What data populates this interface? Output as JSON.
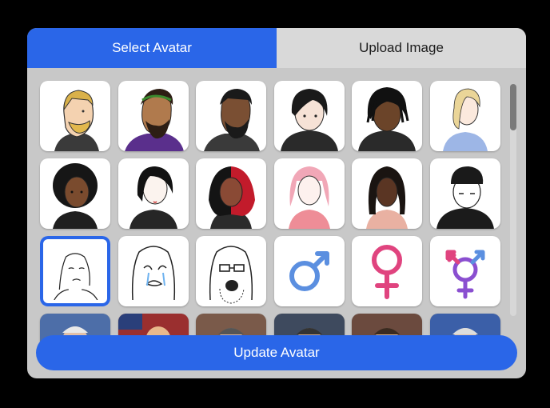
{
  "tabs": {
    "select_label": "Select Avatar",
    "upload_label": "Upload Image"
  },
  "avatars": [
    {
      "id": "chad-blonde",
      "icon": "blonde-bearded-man-avatar"
    },
    {
      "id": "laurel-philosopher",
      "icon": "laurel-wreath-man-avatar"
    },
    {
      "id": "bearded-dark",
      "icon": "bearded-dark-skin-man-avatar"
    },
    {
      "id": "emo-boy",
      "icon": "black-hair-hoodie-boy-avatar"
    },
    {
      "id": "dreads-boy",
      "icon": "dreadlocks-hoodie-avatar"
    },
    {
      "id": "blonde-girl",
      "icon": "blonde-girl-blue-dress-avatar"
    },
    {
      "id": "afro-girl",
      "icon": "afro-girl-avatar"
    },
    {
      "id": "goth-girl",
      "icon": "goth-girl-avatar"
    },
    {
      "id": "red-black-hair-girl",
      "icon": "red-black-hair-girl-avatar"
    },
    {
      "id": "pink-hair-girl",
      "icon": "pink-hair-girl-avatar"
    },
    {
      "id": "braids-girl",
      "icon": "braids-girl-avatar"
    },
    {
      "id": "beanie-wojak",
      "icon": "beanie-wojak-avatar"
    },
    {
      "id": "wojak",
      "icon": "wojak-avatar",
      "selected": true
    },
    {
      "id": "crying-wojak",
      "icon": "crying-wojak-avatar"
    },
    {
      "id": "soyjak",
      "icon": "soyjak-glasses-avatar"
    },
    {
      "id": "male-symbol",
      "icon": "male-symbol-icon"
    },
    {
      "id": "female-symbol",
      "icon": "female-symbol-icon"
    },
    {
      "id": "transgender-symbol",
      "icon": "transgender-symbol-icon"
    },
    {
      "id": "photo-1",
      "icon": "photo-avatar"
    },
    {
      "id": "photo-2",
      "icon": "photo-avatar"
    },
    {
      "id": "photo-3",
      "icon": "photo-avatar"
    },
    {
      "id": "photo-4",
      "icon": "photo-avatar"
    },
    {
      "id": "photo-5",
      "icon": "photo-avatar"
    },
    {
      "id": "photo-6",
      "icon": "photo-avatar"
    }
  ],
  "footer": {
    "update_label": "Update Avatar"
  },
  "colors": {
    "accent": "#2a66e8",
    "male": "#5b8fe0",
    "female": "#e0447f",
    "trans_purple": "#8a4fd0"
  }
}
